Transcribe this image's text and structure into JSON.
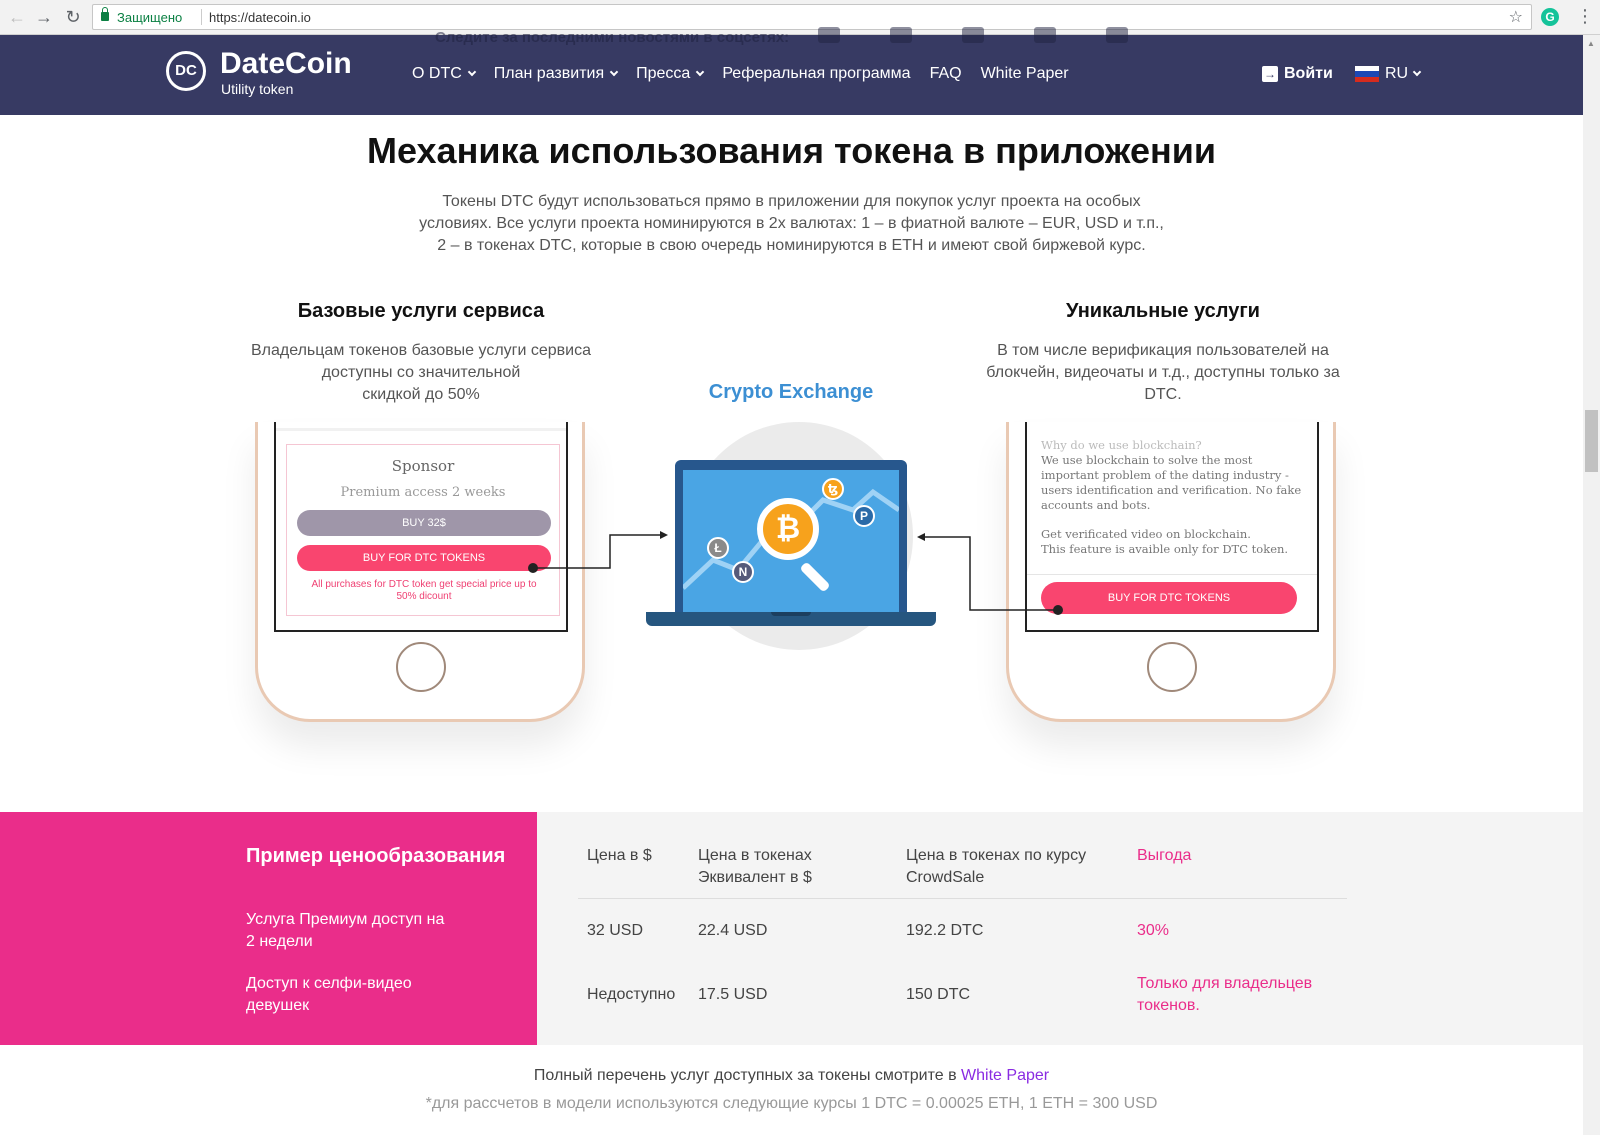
{
  "browser": {
    "secure_label": "Защищено",
    "url": "https://datecoin.io"
  },
  "header": {
    "ghost_text": "Следите за последними новостями в соцсетях:",
    "logo_mark": "DC",
    "logo_name": "DateCoin",
    "logo_sub": "Utility token",
    "nav": [
      {
        "label": "О DTC"
      },
      {
        "label": "План развития"
      },
      {
        "label": "Пресса"
      },
      {
        "label": "Реферальная программа"
      },
      {
        "label": "FAQ"
      },
      {
        "label": "White Paper"
      }
    ],
    "login": "Войти",
    "lang": "RU"
  },
  "main": {
    "title": "Механика использования токена в приложении",
    "intro_1": "Токены DTC будут использоваться прямо в приложении для покупок услуг проекта на особых",
    "intro_2": "условиях. Все услуги проекта номинируются в 2х валютах: 1 – в фиатной валюте – EUR, USD и т.п.,",
    "intro_3": "2 – в токенах DTC, которые в свою очередь номинируются в ETH и имеют свой биржевой курс.",
    "left_title": "Базовые услуги сервиса",
    "left_text_1": "Владельцам токенов базовые услуги сервиса",
    "left_text_2": "доступны со значительной",
    "left_text_3": "скидкой до 50%",
    "right_title": "Уникальные услуги",
    "right_text_1": "В том числе верификация пользователей на",
    "right_text_2": "блокчейн, видеочаты и т.д., доступны только за",
    "right_text_3": "DTC.",
    "crypto_label": "Crypto Exchange"
  },
  "left_phone": {
    "title": "Sponsor",
    "subtitle": "Premium access 2 weeks",
    "buy_usd": "BUY 32$",
    "buy_tokens": "BUY FOR DTC TOKENS",
    "note": "All purchases for DTC token get special price up to 50% dicount"
  },
  "right_phone": {
    "question": "Why do we use blockchain?",
    "answer": "We use blockchain to solve the most important problem of the dating industry - users identification and verification. No fake accounts and bots.",
    "video_1": "Get verificated video on blockchain.",
    "video_2": "This feature is avaible only for DTC token.",
    "buy_tokens": "BUY FOR DTC TOKENS"
  },
  "pricing": {
    "title": "Пример ценообразования",
    "rows": [
      {
        "label_1": "Услуга Премиум доступ на",
        "label_2": "2 недели",
        "price": "32 USD",
        "token_eq": "22.4 USD",
        "crowdsale": "192.2 DTC",
        "benefit_1": "30%",
        "benefit_2": ""
      },
      {
        "label_1": "Доступ к селфи-видео",
        "label_2": "девушек",
        "price": "Недоступно",
        "token_eq": "17.5 USD",
        "crowdsale": "150 DTC",
        "benefit_1": "Только для владельцев",
        "benefit_2": "токенов."
      }
    ],
    "headers": {
      "price": "Цена в $",
      "tokens_1": "Цена в токенах",
      "tokens_2": "Эквивалент в $",
      "crowdsale_1": "Цена в токенах по курсу",
      "crowdsale_2": "CrowdSale",
      "benefit": "Выгода"
    }
  },
  "footer": {
    "text": "Полный перечень услуг доступных за токены смотрите в",
    "link": "White Paper",
    "note": "*для рассчетов в модели используются следующие курсы 1 DTC = 0.00025 ETH, 1 ETH = 300 USD"
  },
  "colors": {
    "header_bg": "#373a63",
    "accent_pink": "#ea2d8a",
    "crypto_blue": "#3c8fd3",
    "button_pink": "#f9456f"
  }
}
